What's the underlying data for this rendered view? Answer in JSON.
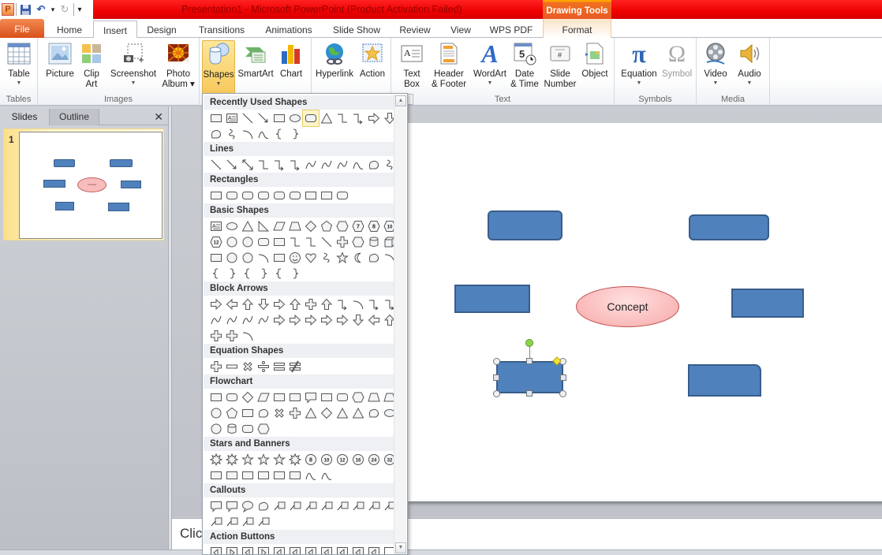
{
  "window": {
    "title": "Presentation1  -  Microsoft PowerPoint (Product Activation Failed)",
    "contextual_tab_group": "Drawing Tools",
    "quick_access": [
      {
        "name": "powerpoint-logo",
        "glyph": "P"
      },
      {
        "name": "save-icon",
        "glyph": "💾"
      },
      {
        "name": "undo-icon",
        "glyph": "↶"
      },
      {
        "name": "undo-dropdown-icon",
        "glyph": "▾"
      },
      {
        "name": "redo-icon",
        "glyph": "↻"
      },
      {
        "name": "customize-qat-icon",
        "glyph": "⩡"
      }
    ]
  },
  "tabs": [
    {
      "label": "File"
    },
    {
      "label": "Home"
    },
    {
      "label": "Insert",
      "active": true
    },
    {
      "label": "Design"
    },
    {
      "label": "Transitions"
    },
    {
      "label": "Animations"
    },
    {
      "label": "Slide Show"
    },
    {
      "label": "Review"
    },
    {
      "label": "View"
    },
    {
      "label": "WPS PDF"
    },
    {
      "label": "Format"
    }
  ],
  "ribbon": {
    "groups": [
      {
        "label": "Tables",
        "buttons": [
          {
            "line1": "Table",
            "line2": "",
            "dropdown": true,
            "icon": "table-icon"
          }
        ]
      },
      {
        "label": "Images",
        "buttons": [
          {
            "line1": "Picture",
            "line2": "",
            "icon": "picture-icon"
          },
          {
            "line1": "Clip",
            "line2": "Art",
            "icon": "clip-art-icon"
          },
          {
            "line1": "Screenshot",
            "line2": "",
            "dropdown": true,
            "icon": "screenshot-icon"
          },
          {
            "line1": "Photo",
            "line2": "Album ▾",
            "icon": "photo-album-icon"
          }
        ]
      },
      {
        "label": "",
        "buttons": [
          {
            "line1": "Shapes",
            "line2": "",
            "dropdown": true,
            "icon": "shapes-icon",
            "active": true
          },
          {
            "line1": "SmartArt",
            "line2": "",
            "icon": "smartart-icon"
          },
          {
            "line1": "Chart",
            "line2": "",
            "icon": "chart-icon"
          }
        ]
      },
      {
        "label": "",
        "buttons": [
          {
            "line1": "Hyperlink",
            "line2": "",
            "icon": "hyperlink-icon"
          },
          {
            "line1": "Action",
            "line2": "",
            "icon": "action-icon"
          }
        ]
      },
      {
        "label": "Text",
        "buttons": [
          {
            "line1": "Text",
            "line2": "Box",
            "icon": "text-box-icon"
          },
          {
            "line1": "Header",
            "line2": "& Footer",
            "icon": "header-footer-icon"
          },
          {
            "line1": "WordArt",
            "line2": "",
            "dropdown": true,
            "icon": "wordart-icon"
          },
          {
            "line1": "Date",
            "line2": "& Time",
            "icon": "date-time-icon"
          },
          {
            "line1": "Slide",
            "line2": "Number",
            "icon": "slide-number-icon"
          },
          {
            "line1": "Object",
            "line2": "",
            "icon": "object-icon"
          }
        ]
      },
      {
        "label": "Symbols",
        "buttons": [
          {
            "line1": "Equation",
            "line2": "",
            "dropdown": true,
            "icon": "equation-icon"
          },
          {
            "line1": "Symbol",
            "line2": "",
            "icon": "symbol-icon",
            "disabled": true
          }
        ]
      },
      {
        "label": "Media",
        "buttons": [
          {
            "line1": "Video",
            "line2": "",
            "dropdown": true,
            "icon": "video-icon"
          },
          {
            "line1": "Audio",
            "line2": "",
            "dropdown": true,
            "icon": "audio-icon"
          }
        ]
      }
    ]
  },
  "shapes_gallery": {
    "sections": [
      {
        "title": "Recently Used Shapes",
        "count": 19
      },
      {
        "title": "Lines",
        "count": 12
      },
      {
        "title": "Rectangles",
        "count": 9
      },
      {
        "title": "Basic Shapes",
        "count": 42
      },
      {
        "title": "Block Arrows",
        "count": 27
      },
      {
        "title": "Equation Shapes",
        "count": 6
      },
      {
        "title": "Flowchart",
        "count": 28
      },
      {
        "title": "Stars and Banners",
        "count": 20
      },
      {
        "title": "Callouts",
        "count": 16
      },
      {
        "title": "Action Buttons",
        "count": 12
      }
    ],
    "badges": {
      "basic": [
        "7",
        "8",
        "10",
        "12"
      ],
      "stars": [
        "8",
        "10",
        "12",
        "16",
        "24",
        "32"
      ]
    }
  },
  "slides_panel": {
    "tabs": [
      "Slides",
      "Outline"
    ],
    "close_glyph": "✕",
    "slides": [
      {
        "number": "1",
        "concept_label": "Concept"
      }
    ]
  },
  "slide": {
    "concept_label": "Concept",
    "shape_fill": "#4f81bd",
    "shape_border": "#385d8a",
    "ellipse_fill": "#f7b7b7"
  },
  "notes": {
    "placeholder": "Click to add notes"
  }
}
